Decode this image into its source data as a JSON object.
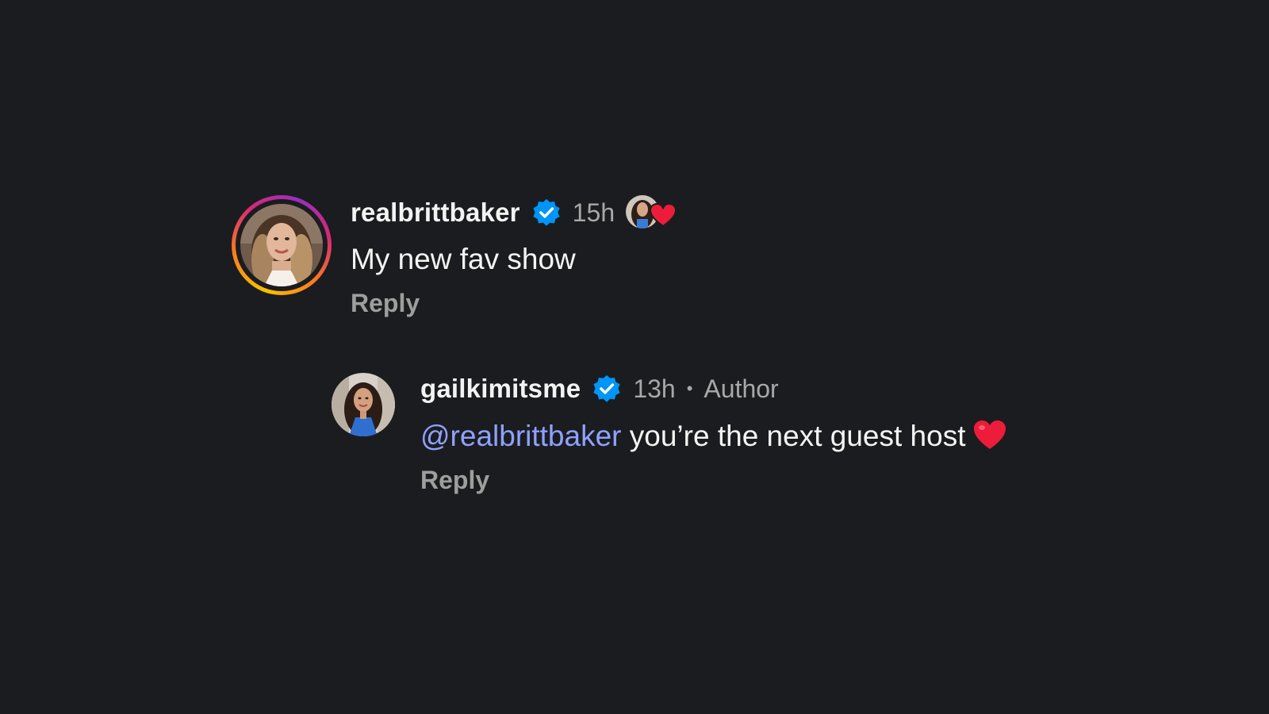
{
  "comments": [
    {
      "username": "realbrittbaker",
      "time": "15h",
      "text": "My new fav show",
      "reply_label": "Reply",
      "verified_icon": "verified-badge-icon",
      "liked_by_author_icon": "heart-icon"
    },
    {
      "username": "gailkimitsme",
      "time": "13h",
      "separator": "•",
      "author_label": "Author",
      "mention": "@realbrittbaker",
      "text": " you’re the next guest host",
      "emoji_icon": "red-heart-icon",
      "reply_label": "Reply",
      "verified_icon": "verified-badge-icon"
    }
  ],
  "colors": {
    "background": "#1b1c1f",
    "verified": "#0095f6",
    "mention": "#8fa1ff",
    "heart": "#ed1c3a",
    "secondary_text": "#a8a8a8"
  }
}
